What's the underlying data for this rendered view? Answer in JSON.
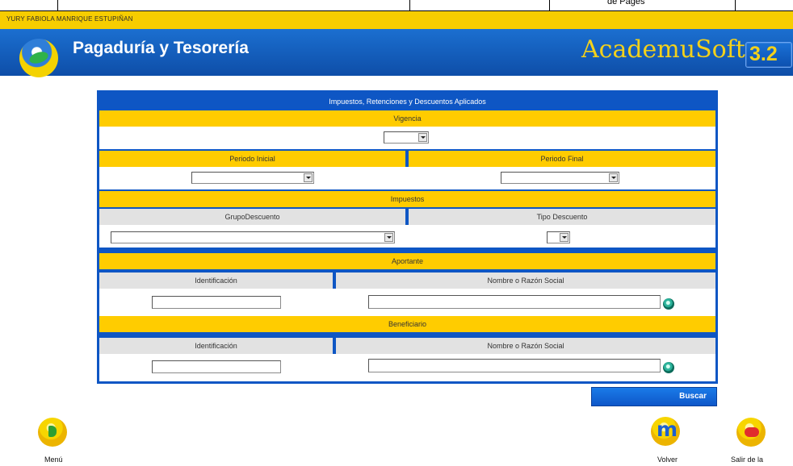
{
  "top_strip": {
    "text": "de Pages"
  },
  "user_bar": {
    "user_name": "YURY FABIOLA MANRIQUE ESTUPIÑAN"
  },
  "header": {
    "module_title": "Pagaduría y Tesorería",
    "brand": "AcademuSoft",
    "version": "3.2"
  },
  "panel": {
    "title": "Impuestos, Retenciones y Descuentos Aplicados",
    "vigencia_label": "Vigencia",
    "periodo_inicial_label": "Periodo Inicial",
    "periodo_final_label": "Periodo Final",
    "impuestos_label": "Impuestos",
    "grupo_descuento_label": "GrupoDescuento",
    "tipo_descuento_label": "Tipo Descuento",
    "aportante_label": "Aportante",
    "aportante_identificacion_label": "Identificación",
    "aportante_nombre_label": "Nombre o Razón Social",
    "beneficiario_label": "Beneficiario",
    "beneficiario_identificacion_label": "Identificación",
    "beneficiario_nombre_label": "Nombre o Razón Social"
  },
  "actions": {
    "buscar": "Buscar"
  },
  "footer": {
    "menu": "Menú",
    "volver": "Volver",
    "salir": "Salir de la"
  }
}
